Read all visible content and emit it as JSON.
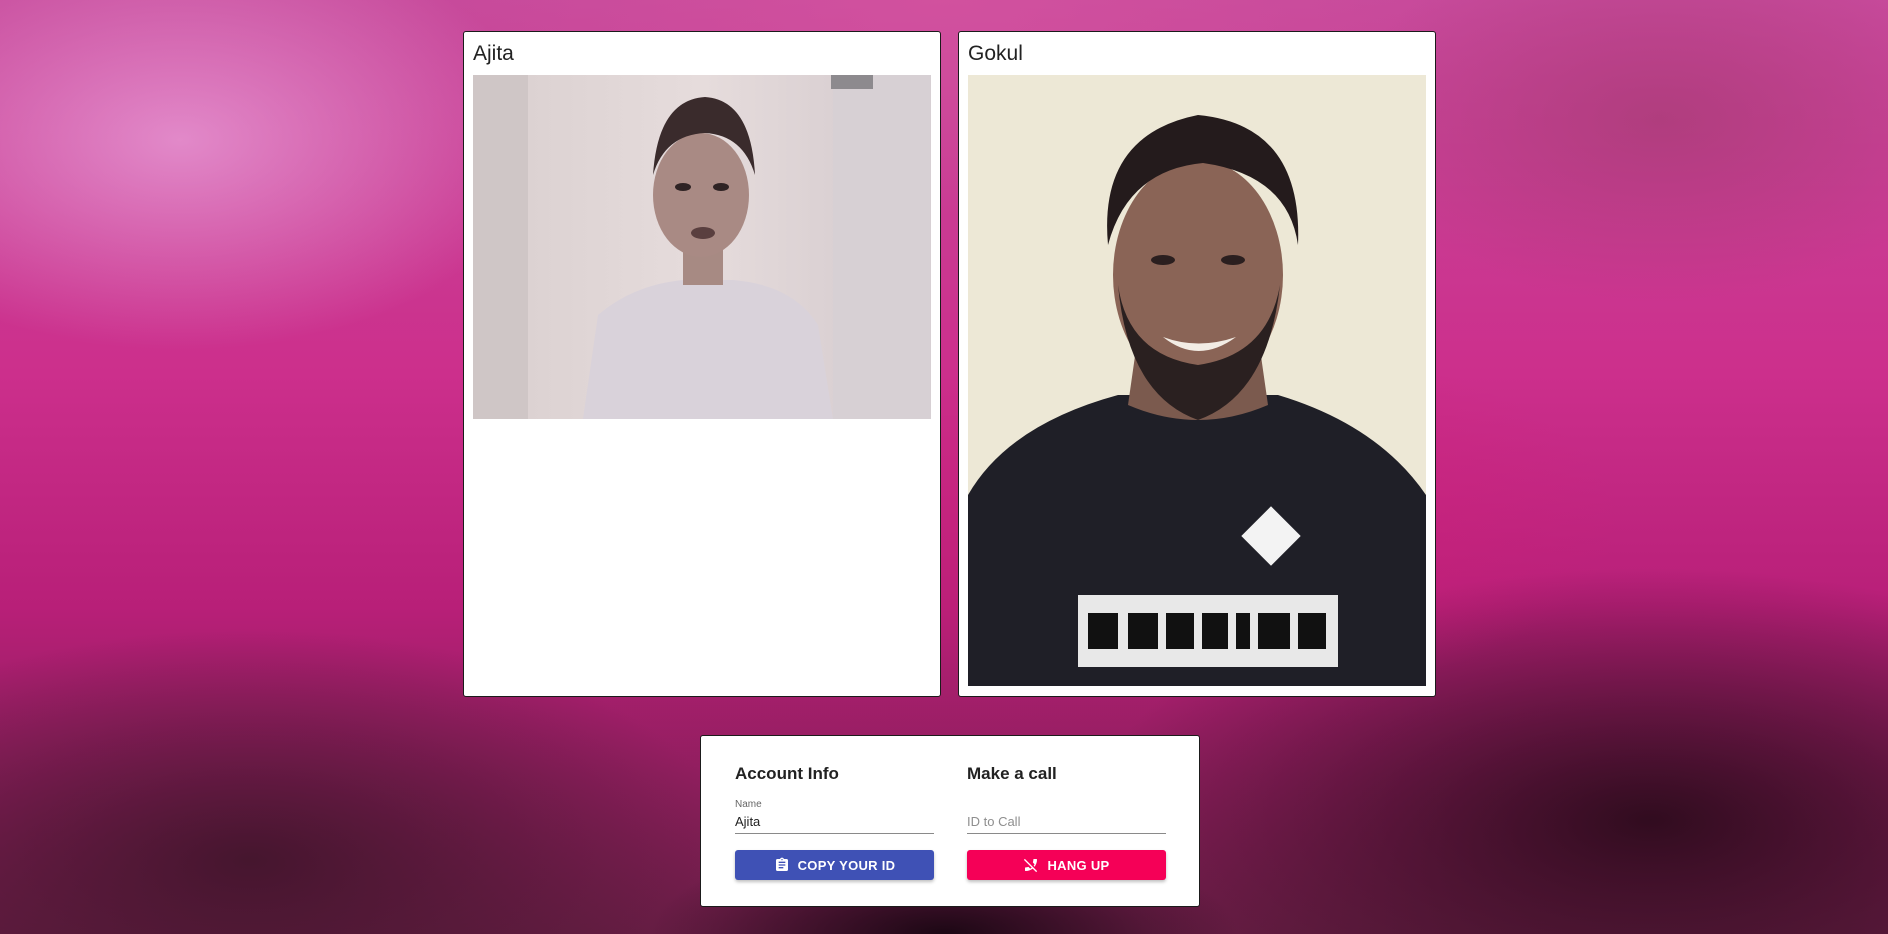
{
  "participants": {
    "local": {
      "name": "Ajita"
    },
    "remote": {
      "name": "Gokul"
    }
  },
  "account_info": {
    "title": "Account Info",
    "name_label": "Name",
    "name_value": "Ajita",
    "copy_button": "COPY YOUR ID",
    "copy_icon": "clipboard-icon"
  },
  "make_call": {
    "title": "Make a call",
    "id_placeholder": "ID to Call",
    "id_value": "",
    "hangup_button": "HANG UP",
    "hangup_icon": "phone-disabled-icon"
  },
  "colors": {
    "primary": "#3f51b5",
    "secondary": "#f50057"
  }
}
